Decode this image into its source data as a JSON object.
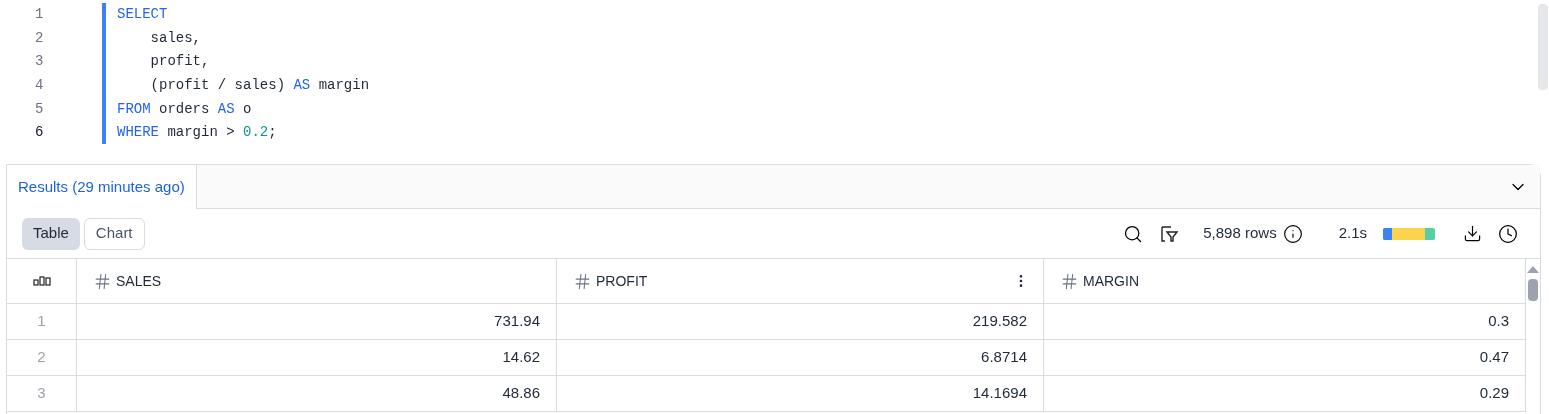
{
  "editor": {
    "lines": [
      {
        "number": "1",
        "current": false,
        "tokens": [
          {
            "kind": "keyword",
            "text": "SELECT"
          }
        ]
      },
      {
        "number": "2",
        "current": false,
        "tokens": [
          {
            "kind": "plain",
            "text": "    sales,"
          }
        ]
      },
      {
        "number": "3",
        "current": false,
        "tokens": [
          {
            "kind": "plain",
            "text": "    profit,"
          }
        ]
      },
      {
        "number": "4",
        "current": false,
        "tokens": [
          {
            "kind": "plain",
            "text": "    (profit / sales) "
          },
          {
            "kind": "keyword",
            "text": "AS"
          },
          {
            "kind": "plain",
            "text": " margin"
          }
        ]
      },
      {
        "number": "5",
        "current": false,
        "tokens": [
          {
            "kind": "keyword",
            "text": "FROM"
          },
          {
            "kind": "plain",
            "text": " orders "
          },
          {
            "kind": "keyword",
            "text": "AS"
          },
          {
            "kind": "plain",
            "text": " o"
          }
        ]
      },
      {
        "number": "6",
        "current": true,
        "tokens": [
          {
            "kind": "keyword",
            "text": "WHERE"
          },
          {
            "kind": "plain",
            "text": " margin > "
          },
          {
            "kind": "number",
            "text": "0.2"
          },
          {
            "kind": "plain",
            "text": ";"
          }
        ]
      }
    ]
  },
  "results": {
    "tabs": [
      {
        "label": "Results (29 minutes ago)",
        "selected": true
      }
    ],
    "views": [
      {
        "label": "Table",
        "selected": true
      },
      {
        "label": "Chart",
        "selected": false
      }
    ],
    "row_count": "5,898 rows",
    "duration": "2.1s",
    "table": {
      "columns": [
        {
          "name": "SALES",
          "menu": false
        },
        {
          "name": "PROFIT",
          "menu": true
        },
        {
          "name": "MARGIN",
          "menu": false
        }
      ],
      "rows": [
        {
          "index": "1",
          "cells": [
            "731.94",
            "219.582",
            "0.3"
          ]
        },
        {
          "index": "2",
          "cells": [
            "14.62",
            "6.8714",
            "0.47"
          ]
        },
        {
          "index": "3",
          "cells": [
            "48.86",
            "14.1694",
            "0.29"
          ]
        }
      ]
    }
  }
}
